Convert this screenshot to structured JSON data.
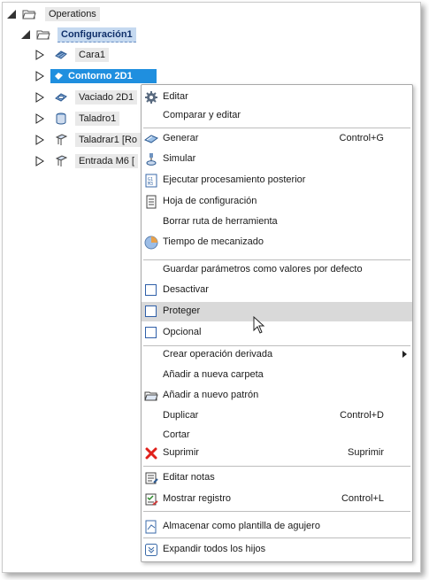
{
  "tree": {
    "root": {
      "label": "Operations"
    },
    "setup": {
      "label": "Configuración1"
    },
    "ops": [
      {
        "label": "Cara1",
        "icon": "face-op-icon"
      },
      {
        "label": "Contorno 2D1",
        "icon": "contour-op-icon"
      },
      {
        "label": "Vaciado 2D1",
        "icon": "pocket-op-icon"
      },
      {
        "label": "Taladro1",
        "icon": "drill-op-icon"
      },
      {
        "label": "Taladrar1 [Ro",
        "icon": "tap-op-icon"
      },
      {
        "label": "Entrada M6 [",
        "icon": "thread-op-icon"
      }
    ]
  },
  "menu": {
    "editar": "Editar",
    "comparar": "Comparar y editar",
    "generar": "Generar",
    "generar_shortcut": "Control+G",
    "simular": "Simular",
    "postproceso": "Ejecutar procesamiento posterior",
    "hoja": "Hoja de configuración",
    "borrar_ruta": "Borrar ruta de herramienta",
    "tiempo": "Tiempo de mecanizado",
    "guardar_param": "Guardar parámetros como valores por defecto",
    "desactivar": "Desactivar",
    "proteger": "Proteger",
    "opcional": "Opcional",
    "derivada": "Crear operación derivada",
    "nueva_carpeta": "Añadir a nueva carpeta",
    "nuevo_patron": "Añadir a nuevo patrón",
    "duplicar": "Duplicar",
    "duplicar_shortcut": "Control+D",
    "cortar": "Cortar",
    "suprimir": "Suprimir",
    "suprimir_shortcut": "Suprimir",
    "editar_notas": "Editar notas",
    "mostrar_registro": "Mostrar registro",
    "mostrar_registro_shortcut": "Control+L",
    "almacenar_plantilla": "Almacenar como plantilla de agujero",
    "expandir": "Expandir todos los hijos"
  },
  "colors": {
    "selection": "#1f8fdf",
    "setup_highlight": "#c5d9f0",
    "menu_hover": "#d9d9d9",
    "delete_red": "#e0201b"
  }
}
